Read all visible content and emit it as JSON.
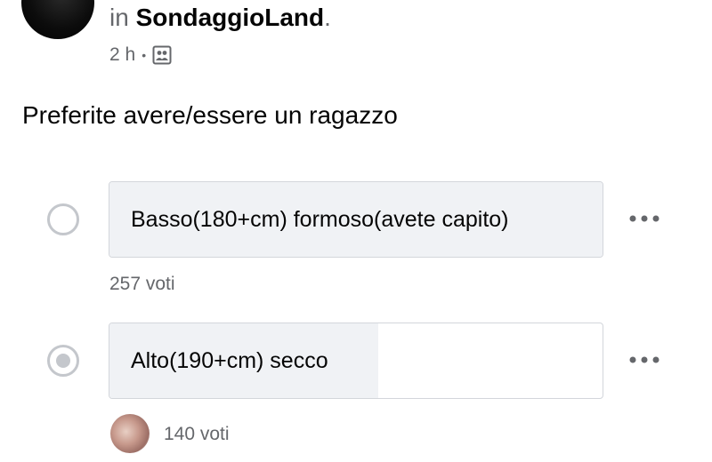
{
  "post": {
    "group_prefix": "in",
    "group_name": "SondaggioLand",
    "group_suffix": ".",
    "time_ago": "2 h",
    "meta_separator": "•",
    "privacy_icon": "group-icon",
    "text": "Preferite avere/essere un ragazzo"
  },
  "poll": {
    "options": [
      {
        "label": "Basso(180+cm) formoso(avete capito)",
        "votes": "257 voti",
        "selected": false,
        "fill_fraction": 1.0
      },
      {
        "label": "Alto(190+cm) secco",
        "votes": "140 voti",
        "selected": true,
        "fill_fraction": 0.545
      }
    ]
  },
  "colors": {
    "primary_text": "#050505",
    "secondary_text": "#65676b",
    "bar_fill": "#f0f2f5",
    "border": "#d3d6db",
    "radio": "#c4c7cc"
  }
}
